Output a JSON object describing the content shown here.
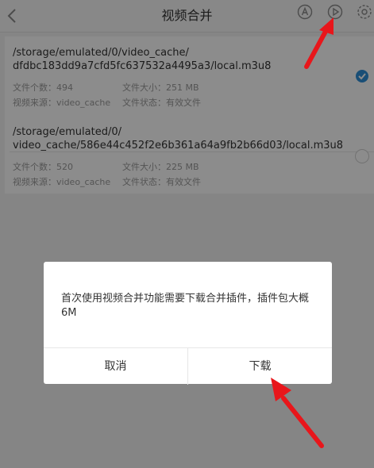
{
  "header": {
    "title": "视频合并",
    "icons": [
      "back-arrow-icon",
      "auto-icon",
      "play-circle-icon",
      "settings-icon"
    ]
  },
  "videos": [
    {
      "path": "/storage/emulated/0/video_cache/\ndfdbc183dd9a7cfd5fc637532a4495a3/local.m3u8",
      "file_count_label": "文件个数：494",
      "file_size_label": "文件大小：251 MB",
      "source_label": "视频来源：video_cache",
      "status_label": "文件状态：有效文件",
      "selected": true
    },
    {
      "path": "/storage/emulated/0/\nvideo_cache/586e44c452f2e6b361a64a9fb2b66d03/local.m3u8",
      "file_count_label": "文件个数：520",
      "file_size_label": "文件大小：225 MB",
      "source_label": "视频来源：video_cache",
      "status_label": "文件状态：有效文件",
      "selected": false
    }
  ],
  "dialog": {
    "message": "首次使用视频合并功能需要下载合并插件，插件包大概6M",
    "cancel_label": "取消",
    "confirm_label": "下载"
  },
  "colors": {
    "accent": "#2f8fd8",
    "annotation_arrow": "#e8161b"
  }
}
